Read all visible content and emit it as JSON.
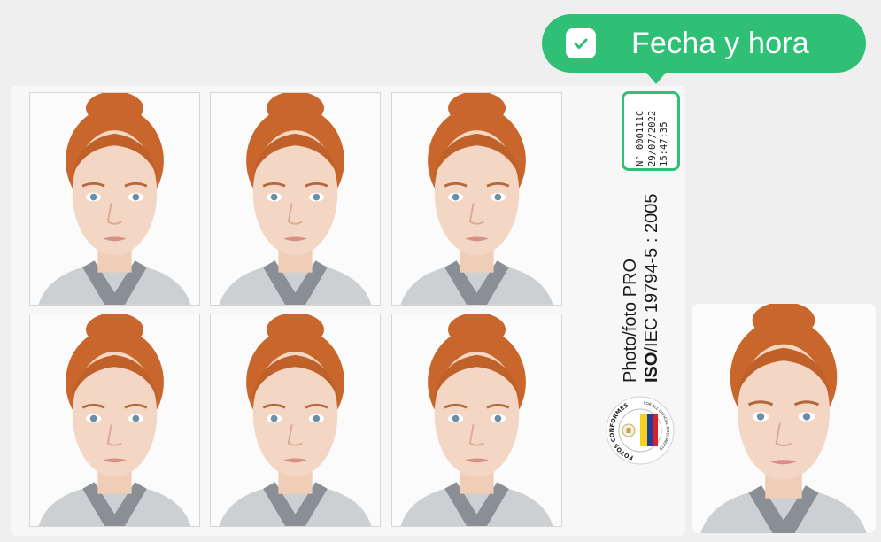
{
  "tooltip": {
    "label": "Fecha y hora",
    "icon": "check-icon",
    "color": "#2fbf75"
  },
  "stamp": {
    "number": "N° 000111C",
    "date": "29/07/2022",
    "time": "15:47:35"
  },
  "print_info": {
    "line1": "Photo/foto PRO",
    "standard_bold": "ISO",
    "standard_rest": "/IEC 19794-5 : 2005"
  },
  "seal": {
    "text_left": "FOTOS CONFORMES",
    "text_right": "FOR ALL OFFICIAL DOCUMENTS",
    "flag_colors": [
      "#f4d21f",
      "#1d3f94",
      "#d81f2a"
    ]
  },
  "photos": {
    "count": 6,
    "single_preview_count": 1
  }
}
